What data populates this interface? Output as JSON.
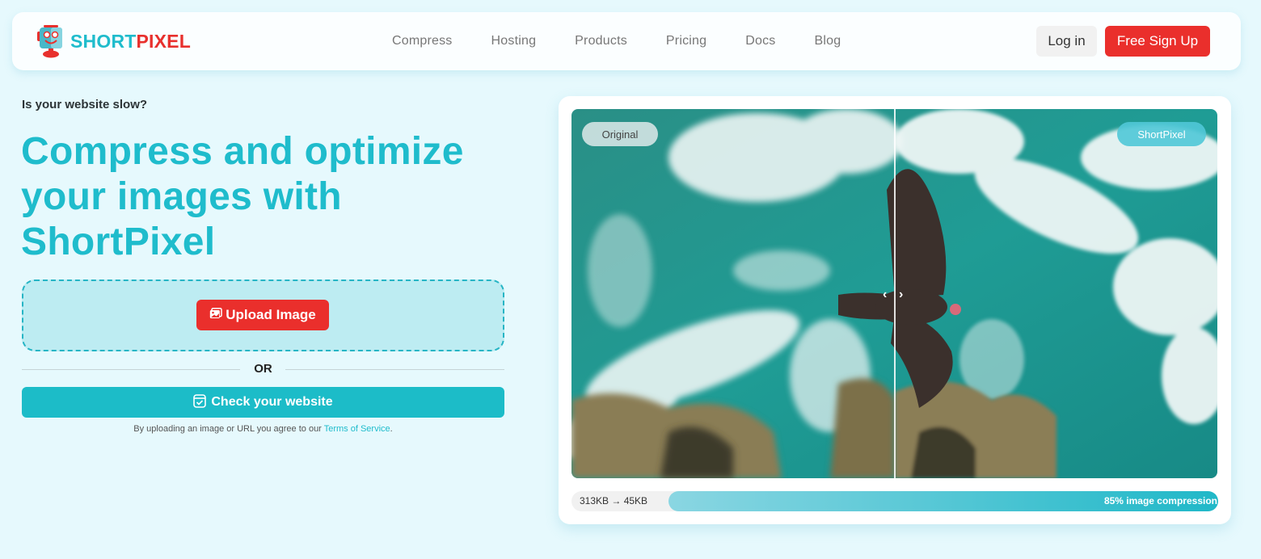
{
  "brand": {
    "name_part1": "SHORT",
    "name_part2": "PIXEL",
    "primary_color": "#1fbccc",
    "accent_color": "#ea2f2c"
  },
  "nav": {
    "items": [
      {
        "label": "Compress"
      },
      {
        "label": "Hosting"
      },
      {
        "label": "Products"
      },
      {
        "label": "Pricing"
      },
      {
        "label": "Docs"
      },
      {
        "label": "Blog"
      }
    ],
    "login_label": "Log in",
    "signup_label": "Free Sign Up"
  },
  "hero": {
    "eyebrow": "Is your website slow?",
    "title_line1": "Compress and optimize",
    "title_line2": "your images with",
    "title_line3": "ShortPixel",
    "upload_label": "Upload Image",
    "upload_icon": "image-icon",
    "or_label": "OR",
    "check_label": "Check your website",
    "check_icon": "calendar-check-icon",
    "terms_prefix": "By uploading an image or URL you agree to our ",
    "terms_link": "Terms of Service",
    "terms_suffix": "."
  },
  "comparison": {
    "left_badge": "Original",
    "right_badge": "ShortPixel",
    "handle_left": "‹",
    "handle_right": "›",
    "size_before": "313KB",
    "size_after": "45KB",
    "size_text": "313KB → 45KB",
    "compression_percent": 85,
    "compression_label": "85% image compression"
  }
}
